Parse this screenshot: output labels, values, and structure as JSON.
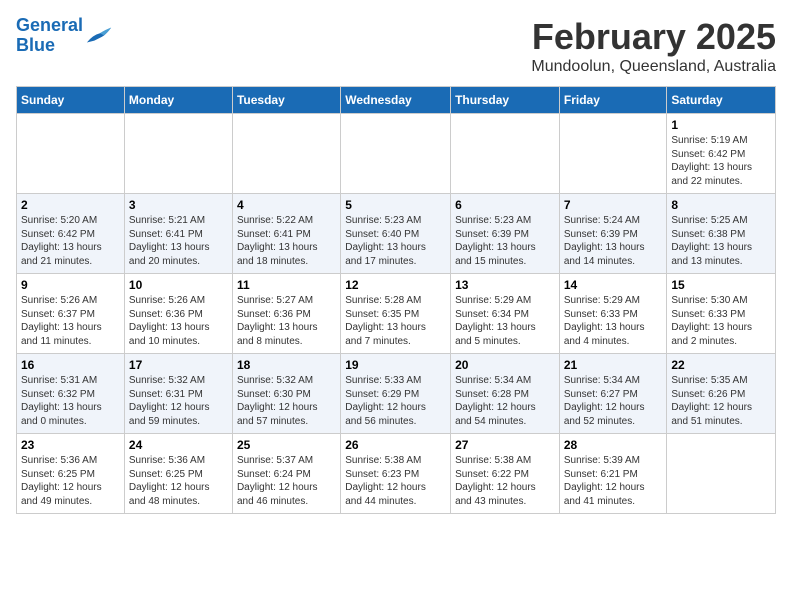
{
  "header": {
    "logo_line1": "General",
    "logo_line2": "Blue",
    "title": "February 2025",
    "subtitle": "Mundoolun, Queensland, Australia"
  },
  "weekdays": [
    "Sunday",
    "Monday",
    "Tuesday",
    "Wednesday",
    "Thursday",
    "Friday",
    "Saturday"
  ],
  "weeks": [
    [
      {
        "day": "",
        "info": ""
      },
      {
        "day": "",
        "info": ""
      },
      {
        "day": "",
        "info": ""
      },
      {
        "day": "",
        "info": ""
      },
      {
        "day": "",
        "info": ""
      },
      {
        "day": "",
        "info": ""
      },
      {
        "day": "1",
        "info": "Sunrise: 5:19 AM\nSunset: 6:42 PM\nDaylight: 13 hours\nand 22 minutes."
      }
    ],
    [
      {
        "day": "2",
        "info": "Sunrise: 5:20 AM\nSunset: 6:42 PM\nDaylight: 13 hours\nand 21 minutes."
      },
      {
        "day": "3",
        "info": "Sunrise: 5:21 AM\nSunset: 6:41 PM\nDaylight: 13 hours\nand 20 minutes."
      },
      {
        "day": "4",
        "info": "Sunrise: 5:22 AM\nSunset: 6:41 PM\nDaylight: 13 hours\nand 18 minutes."
      },
      {
        "day": "5",
        "info": "Sunrise: 5:23 AM\nSunset: 6:40 PM\nDaylight: 13 hours\nand 17 minutes."
      },
      {
        "day": "6",
        "info": "Sunrise: 5:23 AM\nSunset: 6:39 PM\nDaylight: 13 hours\nand 15 minutes."
      },
      {
        "day": "7",
        "info": "Sunrise: 5:24 AM\nSunset: 6:39 PM\nDaylight: 13 hours\nand 14 minutes."
      },
      {
        "day": "8",
        "info": "Sunrise: 5:25 AM\nSunset: 6:38 PM\nDaylight: 13 hours\nand 13 minutes."
      }
    ],
    [
      {
        "day": "9",
        "info": "Sunrise: 5:26 AM\nSunset: 6:37 PM\nDaylight: 13 hours\nand 11 minutes."
      },
      {
        "day": "10",
        "info": "Sunrise: 5:26 AM\nSunset: 6:36 PM\nDaylight: 13 hours\nand 10 minutes."
      },
      {
        "day": "11",
        "info": "Sunrise: 5:27 AM\nSunset: 6:36 PM\nDaylight: 13 hours\nand 8 minutes."
      },
      {
        "day": "12",
        "info": "Sunrise: 5:28 AM\nSunset: 6:35 PM\nDaylight: 13 hours\nand 7 minutes."
      },
      {
        "day": "13",
        "info": "Sunrise: 5:29 AM\nSunset: 6:34 PM\nDaylight: 13 hours\nand 5 minutes."
      },
      {
        "day": "14",
        "info": "Sunrise: 5:29 AM\nSunset: 6:33 PM\nDaylight: 13 hours\nand 4 minutes."
      },
      {
        "day": "15",
        "info": "Sunrise: 5:30 AM\nSunset: 6:33 PM\nDaylight: 13 hours\nand 2 minutes."
      }
    ],
    [
      {
        "day": "16",
        "info": "Sunrise: 5:31 AM\nSunset: 6:32 PM\nDaylight: 13 hours\nand 0 minutes."
      },
      {
        "day": "17",
        "info": "Sunrise: 5:32 AM\nSunset: 6:31 PM\nDaylight: 12 hours\nand 59 minutes."
      },
      {
        "day": "18",
        "info": "Sunrise: 5:32 AM\nSunset: 6:30 PM\nDaylight: 12 hours\nand 57 minutes."
      },
      {
        "day": "19",
        "info": "Sunrise: 5:33 AM\nSunset: 6:29 PM\nDaylight: 12 hours\nand 56 minutes."
      },
      {
        "day": "20",
        "info": "Sunrise: 5:34 AM\nSunset: 6:28 PM\nDaylight: 12 hours\nand 54 minutes."
      },
      {
        "day": "21",
        "info": "Sunrise: 5:34 AM\nSunset: 6:27 PM\nDaylight: 12 hours\nand 52 minutes."
      },
      {
        "day": "22",
        "info": "Sunrise: 5:35 AM\nSunset: 6:26 PM\nDaylight: 12 hours\nand 51 minutes."
      }
    ],
    [
      {
        "day": "23",
        "info": "Sunrise: 5:36 AM\nSunset: 6:25 PM\nDaylight: 12 hours\nand 49 minutes."
      },
      {
        "day": "24",
        "info": "Sunrise: 5:36 AM\nSunset: 6:25 PM\nDaylight: 12 hours\nand 48 minutes."
      },
      {
        "day": "25",
        "info": "Sunrise: 5:37 AM\nSunset: 6:24 PM\nDaylight: 12 hours\nand 46 minutes."
      },
      {
        "day": "26",
        "info": "Sunrise: 5:38 AM\nSunset: 6:23 PM\nDaylight: 12 hours\nand 44 minutes."
      },
      {
        "day": "27",
        "info": "Sunrise: 5:38 AM\nSunset: 6:22 PM\nDaylight: 12 hours\nand 43 minutes."
      },
      {
        "day": "28",
        "info": "Sunrise: 5:39 AM\nSunset: 6:21 PM\nDaylight: 12 hours\nand 41 minutes."
      },
      {
        "day": "",
        "info": ""
      }
    ]
  ]
}
